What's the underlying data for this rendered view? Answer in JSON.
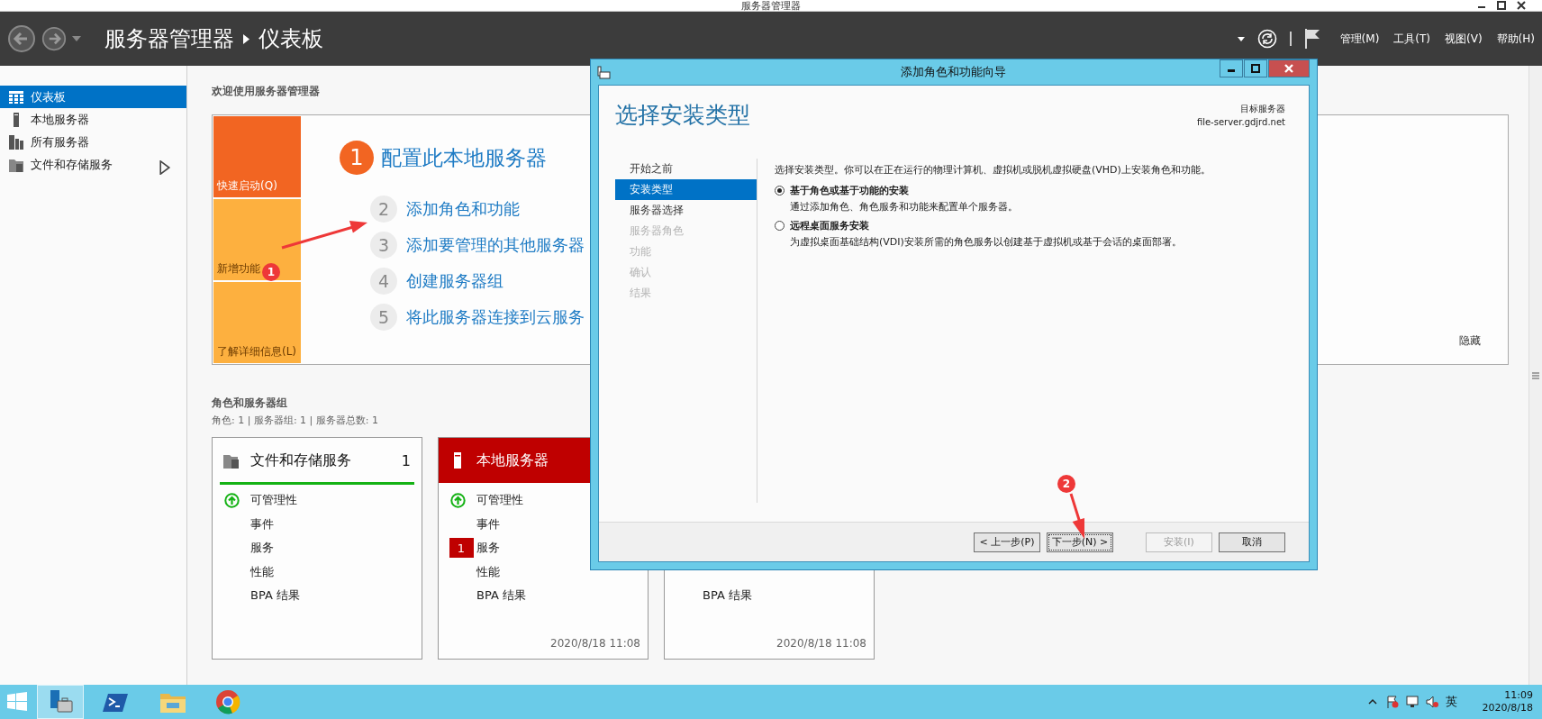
{
  "window": {
    "title": "服务器管理器"
  },
  "header": {
    "breadcrumb": [
      "服务器管理器",
      "仪表板"
    ],
    "menus": [
      "管理(M)",
      "工具(T)",
      "视图(V)",
      "帮助(H)"
    ]
  },
  "sidebar": {
    "items": [
      {
        "label": "仪表板",
        "selected": true,
        "expandable": false
      },
      {
        "label": "本地服务器",
        "selected": false,
        "expandable": false
      },
      {
        "label": "所有服务器",
        "selected": false,
        "expandable": false
      },
      {
        "label": "文件和存储服务",
        "selected": false,
        "expandable": true
      }
    ]
  },
  "welcome": {
    "title": "欢迎使用服务器管理器",
    "tiles": [
      {
        "label": "快速启动(Q)",
        "color": "#f26522"
      },
      {
        "label": "新增功能",
        "color": "#fdb03f"
      },
      {
        "label": "了解详细信息(L)",
        "color": "#fdb03f"
      }
    ],
    "steps": [
      {
        "number": "1",
        "label": "配置此本地服务器",
        "kind": "current"
      },
      {
        "number": "2",
        "label": "添加角色和功能",
        "kind": "todo"
      },
      {
        "number": "3",
        "label": "添加要管理的其他服务器",
        "kind": "todo"
      },
      {
        "number": "4",
        "label": "创建服务器组",
        "kind": "todo"
      },
      {
        "number": "5",
        "label": "将此服务器连接到云服务",
        "kind": "todo"
      }
    ],
    "hide": "隐藏"
  },
  "roles": {
    "title": "角色和服务器组",
    "summary": "角色: 1 | 服务器组: 1 | 服务器总数: 1",
    "cards": [
      {
        "kind": "healthy",
        "title": "文件和存储服务",
        "count": "1",
        "rows": [
          {
            "label": "可管理性",
            "kind": "ok"
          },
          {
            "label": "事件",
            "kind": "plain"
          },
          {
            "label": "服务",
            "kind": "plain"
          },
          {
            "label": "性能",
            "kind": "plain"
          },
          {
            "label": "BPA 结果",
            "kind": "plain"
          }
        ]
      },
      {
        "kind": "alert",
        "title": "本地服务器",
        "rows": [
          {
            "label": "可管理性",
            "kind": "ok"
          },
          {
            "label": "事件",
            "kind": "plain"
          },
          {
            "label": "服务",
            "kind": "alert",
            "count": "1"
          },
          {
            "label": "性能",
            "kind": "plain"
          },
          {
            "label": "BPA 结果",
            "kind": "plain"
          }
        ],
        "time": "2020/8/18 11:08"
      },
      {
        "kind": "covered",
        "rows": [
          {
            "label": "BPA 结果",
            "kind": "plain"
          }
        ],
        "time": "2020/8/18 11:08"
      }
    ]
  },
  "dialog": {
    "title": "添加角色和功能向导",
    "heading": "选择安装类型",
    "target_label": "目标服务器",
    "target": "file-server.gdjrd.net",
    "steps": [
      {
        "label": "开始之前",
        "selected": false,
        "disabled": false
      },
      {
        "label": "安装类型",
        "selected": true,
        "disabled": false
      },
      {
        "label": "服务器选择",
        "selected": false,
        "disabled": false
      },
      {
        "label": "服务器角色",
        "selected": false,
        "disabled": true
      },
      {
        "label": "功能",
        "selected": false,
        "disabled": true
      },
      {
        "label": "确认",
        "selected": false,
        "disabled": true
      },
      {
        "label": "结果",
        "selected": false,
        "disabled": true
      }
    ],
    "intro": "选择安装类型。你可以在正在运行的物理计算机、虚拟机或脱机虚拟硬盘(VHD)上安装角色和功能。",
    "options": [
      {
        "label": "基于角色或基于功能的安装",
        "description": "通过添加角色、角色服务和功能来配置单个服务器。",
        "selected": true
      },
      {
        "label": "远程桌面服务安装",
        "description": "为虚拟桌面基础结构(VDI)安装所需的角色服务以创建基于虚拟机或基于会话的桌面部署。",
        "selected": false
      }
    ],
    "buttons": [
      {
        "label": "< 上一步(P)",
        "disabled": false,
        "focused": false
      },
      {
        "label": "下一步(N) >",
        "disabled": false,
        "focused": true
      },
      {
        "label": "安装(I)",
        "disabled": true,
        "focused": false
      },
      {
        "label": "取消",
        "disabled": false,
        "focused": false
      }
    ]
  },
  "annotations": [
    {
      "number": "1"
    },
    {
      "number": "2"
    }
  ],
  "taskbar": {
    "apps": [
      {
        "selected": true
      },
      {
        "selected": false
      },
      {
        "selected": false
      },
      {
        "selected": false
      }
    ],
    "ime": "英",
    "time": "11:09",
    "date": "2020/8/18"
  }
}
